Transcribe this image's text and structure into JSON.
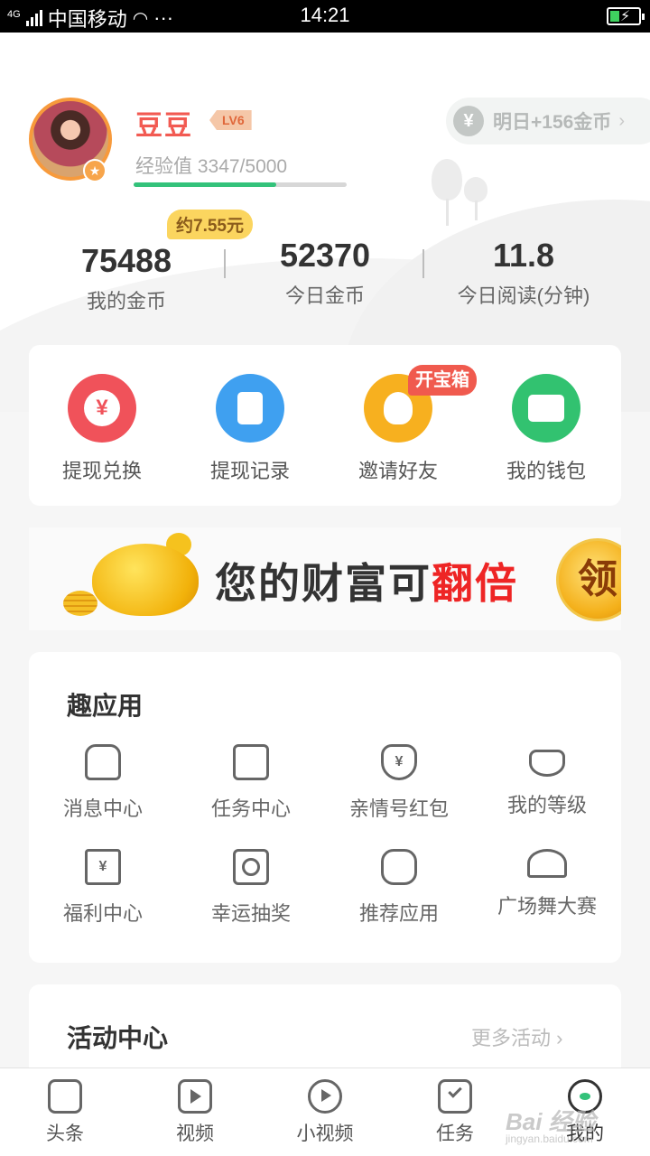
{
  "status_bar": {
    "network": "4G",
    "carrier": "中国移动",
    "dots": "···",
    "time": "14:21"
  },
  "profile": {
    "username": "豆豆",
    "level": "LV6",
    "exp_text": "经验值 3347/5000",
    "exp_progress": 0.67,
    "tomorrow_bonus": "明日+156金币",
    "tomorrow_currency_icon": "yen-icon"
  },
  "stats": {
    "approx_money": "约7.55元",
    "coins": {
      "value": "75488",
      "label": "我的金币"
    },
    "today_coins": {
      "value": "52370",
      "label": "今日金币"
    },
    "today_reading": {
      "value": "11.8",
      "label": "今日阅读(分钟)"
    }
  },
  "shortcuts": {
    "items": [
      {
        "label": "提现兑换",
        "icon": "yen-icon",
        "color": "#f0525a"
      },
      {
        "label": "提现记录",
        "icon": "document-icon",
        "color": "#3fa0f0"
      },
      {
        "label": "邀请好友",
        "icon": "friend-icon",
        "color": "#f7b01f"
      },
      {
        "label": "我的钱包",
        "icon": "wallet-icon",
        "color": "#32c270"
      }
    ],
    "chest_tag": "开宝箱"
  },
  "banner": {
    "text_main": "您的财富可",
    "text_highlight": "翻倍",
    "button_label": "领"
  },
  "fun_apps": {
    "title": "趣应用",
    "items": [
      {
        "label": "消息中心",
        "icon": "bell-icon"
      },
      {
        "label": "任务中心",
        "icon": "task-list-icon"
      },
      {
        "label": "亲情号红包",
        "icon": "red-packet-heart-icon"
      },
      {
        "label": "我的等级",
        "icon": "level-diamond-icon"
      },
      {
        "label": "福利中心",
        "icon": "yen-gift-icon"
      },
      {
        "label": "幸运抽奖",
        "icon": "lottery-icon"
      },
      {
        "label": "推荐应用",
        "icon": "robot-icon"
      },
      {
        "label": "广场舞大赛",
        "icon": "fan-icon"
      }
    ]
  },
  "activity": {
    "title": "活动中心",
    "more": "更多活动",
    "more_arrow": "›"
  },
  "tabbar": {
    "items": [
      {
        "label": "头条",
        "icon": "news-icon"
      },
      {
        "label": "视频",
        "icon": "video-icon"
      },
      {
        "label": "小视频",
        "icon": "short-video-icon"
      },
      {
        "label": "任务",
        "icon": "task-icon"
      },
      {
        "label": "我的",
        "icon": "profile-icon",
        "active": true
      }
    ]
  },
  "watermark": {
    "text": "Bai 经验",
    "sub": "jingyan.baidu.com"
  }
}
